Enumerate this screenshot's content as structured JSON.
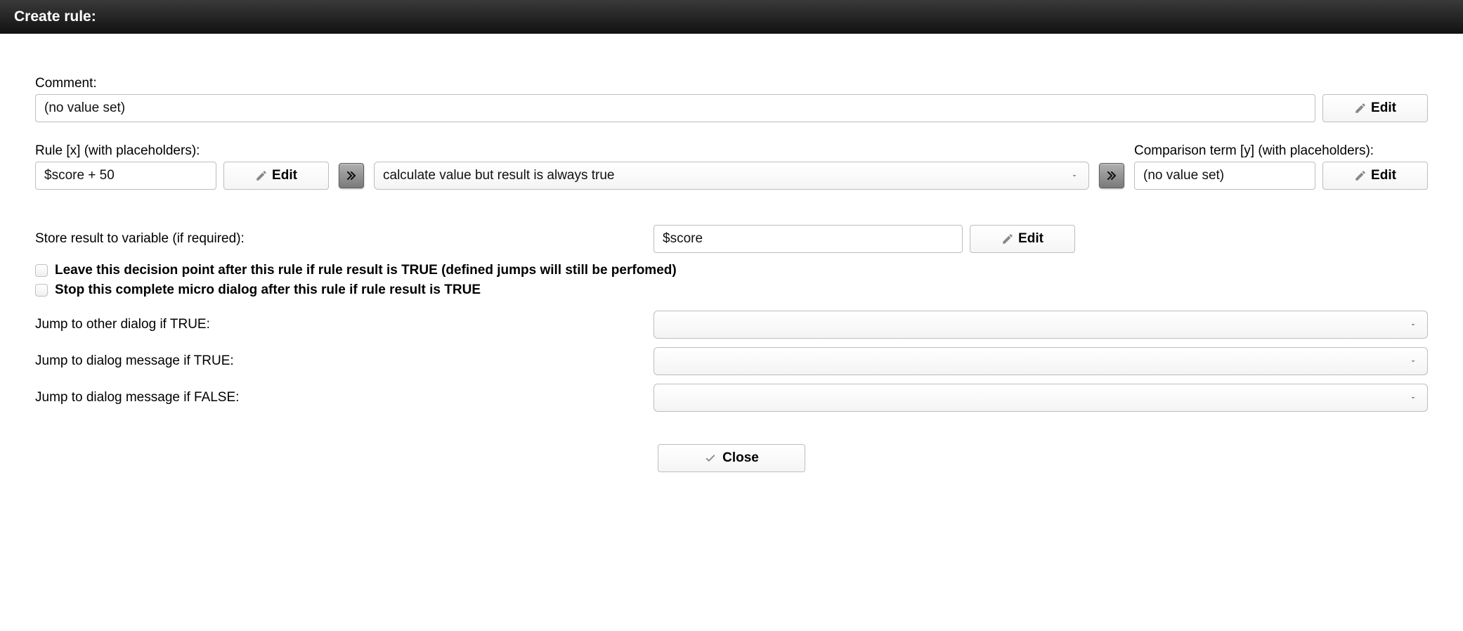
{
  "header": {
    "title": "Create rule:"
  },
  "comment": {
    "label": "Comment:",
    "value": "(no value set)",
    "edit_label": "Edit"
  },
  "rule_x": {
    "label": "Rule [x] (with placeholders):",
    "value": "$score + 50",
    "edit_label": "Edit"
  },
  "comparator": {
    "selected": "calculate value but result is always true"
  },
  "rule_y": {
    "label": "Comparison term [y] (with placeholders):",
    "value": "(no value set)",
    "edit_label": "Edit"
  },
  "store": {
    "label": "Store result to variable (if required):",
    "value": "$score",
    "edit_label": "Edit"
  },
  "checkboxes": {
    "leave_label": "Leave this decision point after this rule if rule result is TRUE (defined jumps will still be perfomed)",
    "stop_label": "Stop this complete micro dialog after this rule if rule result is TRUE"
  },
  "jumps": {
    "to_dialog_true_label": "Jump to other dialog if TRUE:",
    "to_msg_true_label": "Jump to dialog message if TRUE:",
    "to_msg_false_label": "Jump to dialog message if FALSE:",
    "to_dialog_true_value": "",
    "to_msg_true_value": "",
    "to_msg_false_value": ""
  },
  "footer": {
    "close_label": "Close"
  }
}
